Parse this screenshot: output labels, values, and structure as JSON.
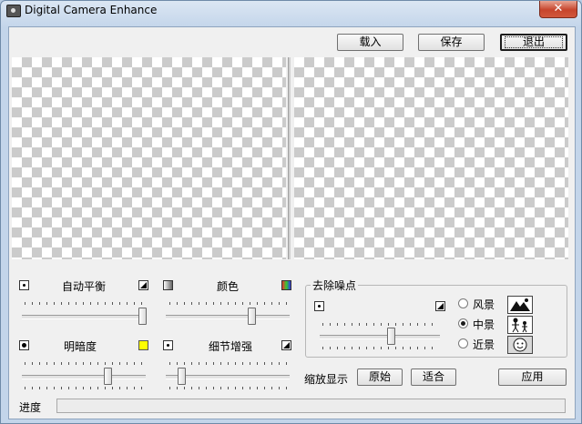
{
  "window": {
    "title": "Digital Camera Enhance",
    "close_label": "✕"
  },
  "toolbar": {
    "load_label": "载入",
    "save_label": "保存",
    "exit_label": "退出"
  },
  "adjust": {
    "auto_balance": {
      "label": "自动平衡",
      "value": 1.0
    },
    "color": {
      "label": "颜色",
      "value": 0.7
    },
    "brightness": {
      "label": "明暗度",
      "value": 0.7
    },
    "detail": {
      "label": "细节增强",
      "value": 0.1
    }
  },
  "denoise": {
    "title": "去除噪点",
    "value": 0.6,
    "options": [
      {
        "label": "风景",
        "selected": false,
        "icon": "mountain-icon"
      },
      {
        "label": "中景",
        "selected": true,
        "icon": "people-icon"
      },
      {
        "label": "近景",
        "selected": false,
        "icon": "face-icon"
      }
    ]
  },
  "zoom": {
    "label": "缩放显示",
    "original_label": "原始",
    "fit_label": "适合"
  },
  "apply_label": "应用",
  "progress": {
    "label": "进度",
    "value": 0.0
  },
  "colors": {
    "accent": "#f0f0f0",
    "close": "#c7452c"
  }
}
